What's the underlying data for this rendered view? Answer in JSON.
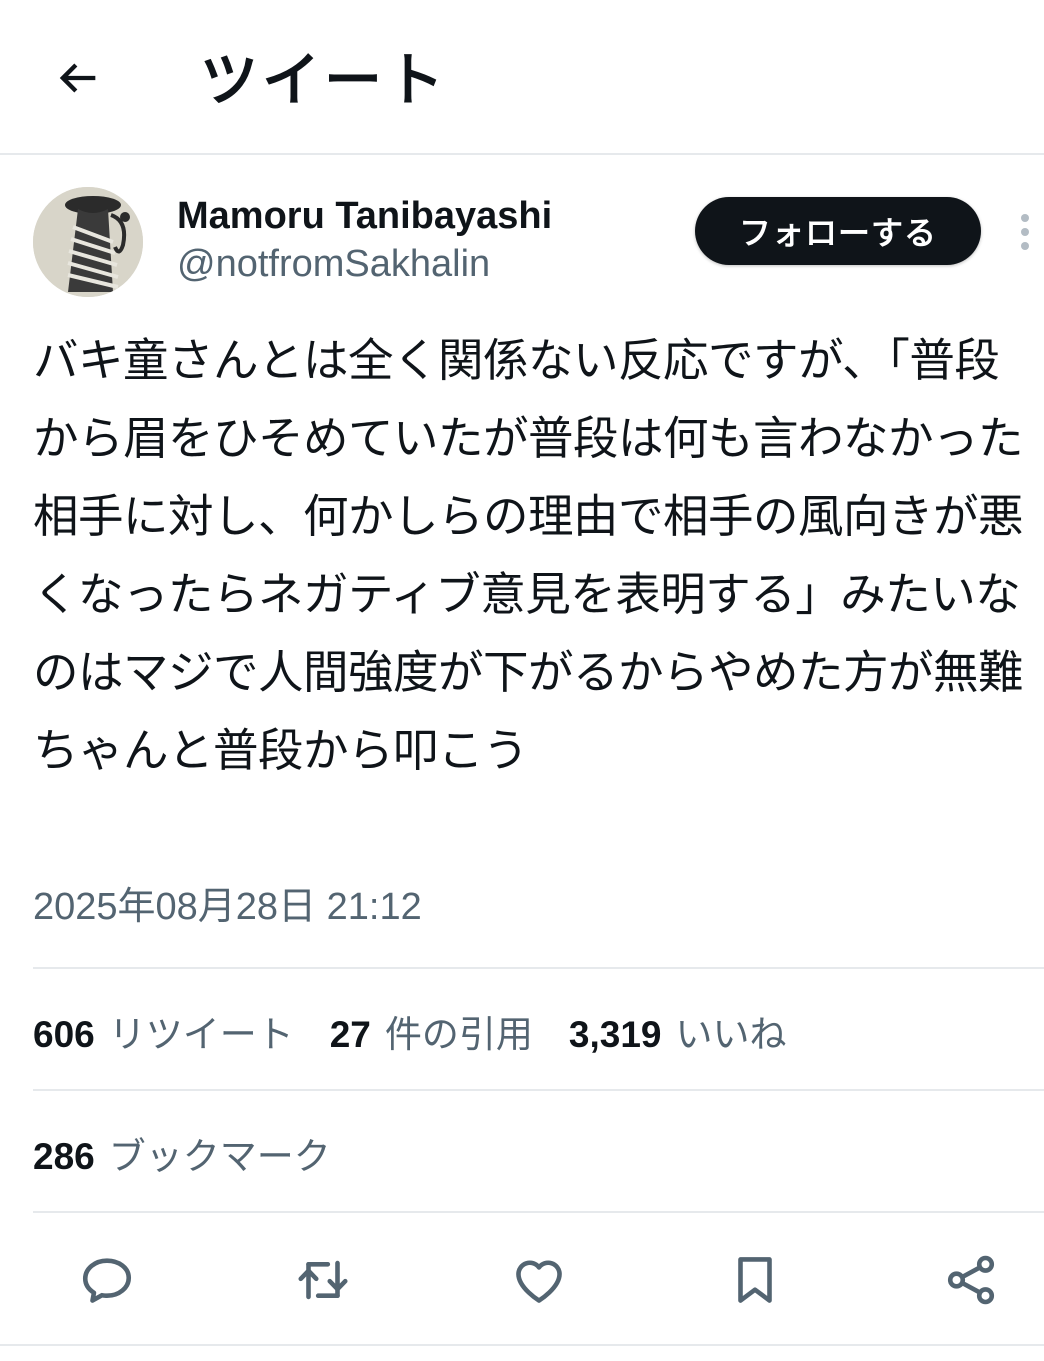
{
  "header": {
    "title": "ツイート",
    "back_icon": "arrow-left-icon"
  },
  "author": {
    "name": "Mamoru Tanibayashi",
    "handle": "@notfromSakhalin"
  },
  "follow_label": "フォローする",
  "tweet": {
    "text": "バキ童さんとは全く関係ない反応ですが、「普段から眉をひそめていたが普段は何も言わなかった相手に対し、何かしらの理由で相手の風向きが悪くなったらネガティブ意見を表明する」みたいなのはマジで人間強度が下がるからやめた方が無難　ちゃんと普段から叩こう",
    "timestamp": "2025年08月28日 21:12"
  },
  "stats": {
    "retweets": {
      "count": "606",
      "label": "リツイート"
    },
    "quotes": {
      "count": "27",
      "label": "件の引用"
    },
    "likes": {
      "count": "3,319",
      "label": "いいね"
    },
    "bookmarks": {
      "count": "286",
      "label": "ブックマーク"
    }
  },
  "actions": [
    "reply-icon",
    "retweet-icon",
    "like-icon",
    "bookmark-icon",
    "share-icon"
  ],
  "colors": {
    "text": "#0f1419",
    "secondary": "#536471",
    "divider": "#e6e9ec",
    "button": "#0f1419"
  }
}
